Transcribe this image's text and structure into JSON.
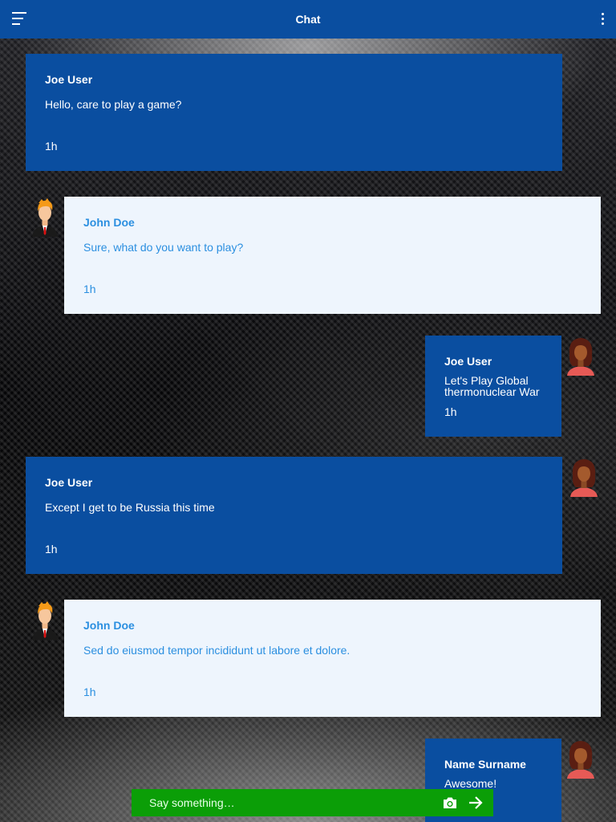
{
  "header": {
    "title": "Chat",
    "menu_icon": "hamburger-menu-icon",
    "more_icon": "more-vert-icon"
  },
  "messages": [
    {
      "name": "Joe User",
      "text": "Hello, care to play a game?",
      "time": "1h"
    },
    {
      "name": "John Doe",
      "text": "Sure, what do you want to play?",
      "time": "1h",
      "avatar": "male-avatar-icon"
    },
    {
      "name": "Joe User",
      "text_line1": "Let's  Play Global",
      "text_line2": "thermonuclear War",
      "time": "1h",
      "avatar": "female-avatar-icon"
    },
    {
      "name": "Joe User",
      "text": "Except I get to be Russia this time",
      "time": "1h",
      "avatar": "female-avatar-icon"
    },
    {
      "name": "John Doe",
      "text": "Sed do eiusmod tempor incididunt ut labore et dolore.",
      "time": "1h",
      "avatar": "male-avatar-icon"
    },
    {
      "name": "Name Surname",
      "text": "Awesome!",
      "avatar": "female-avatar-icon"
    }
  ],
  "composer": {
    "placeholder": "Say something…",
    "camera_icon": "camera-icon",
    "send_icon": "send-arrow-icon"
  },
  "colors": {
    "primary": "#0a4ea0",
    "light_bubble": "#eef5fd",
    "light_text": "#2b8fe0",
    "composer": "#0b9e07"
  }
}
